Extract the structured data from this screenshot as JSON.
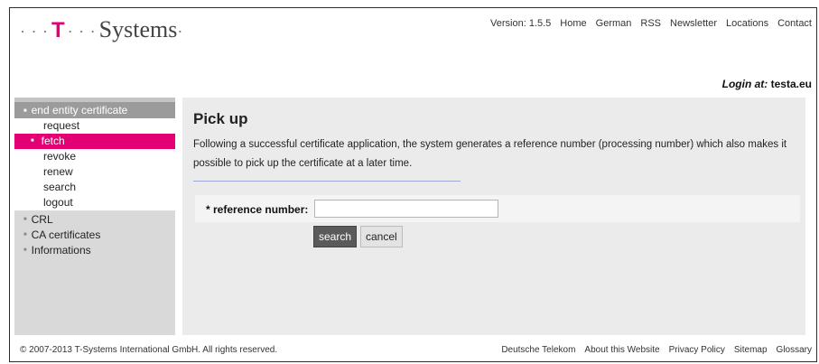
{
  "logo": {
    "dots_left": "· · ·",
    "t": "T",
    "dots_mid": "· · ·",
    "word": "Systems",
    "dot_right": "·"
  },
  "topnav": {
    "version": "Version: 1.5.5",
    "items": [
      "Home",
      "German",
      "RSS",
      "Newsletter",
      "Locations",
      "Contact"
    ]
  },
  "login": {
    "label": "Login at:",
    "value": "testa.eu"
  },
  "sidebar": {
    "section": "end entity certificate",
    "sub_items": [
      "request",
      "fetch",
      "revoke",
      "renew",
      "search",
      "logout"
    ],
    "active": "fetch",
    "other_items": [
      "CRL",
      "CA certificates",
      "Informations"
    ]
  },
  "main": {
    "title": "Pick up",
    "description": "Following a successful certificate application, the system generates a reference number (processing number) which also makes it possible to pick up the certificate at a later time.",
    "field_label": "* reference number:",
    "field_value": "",
    "search_label": "search",
    "cancel_label": "cancel"
  },
  "footer": {
    "copyright": "© 2007-2013 T-Systems International GmbH. All rights reserved.",
    "links": [
      "Deutsche Telekom",
      "About this Website",
      "Privacy Policy",
      "Sitemap",
      "Glossary"
    ]
  },
  "colors": {
    "brand": "#e20074",
    "menu_head": "#9b9b9b",
    "content_bg": "#ebebeb"
  }
}
